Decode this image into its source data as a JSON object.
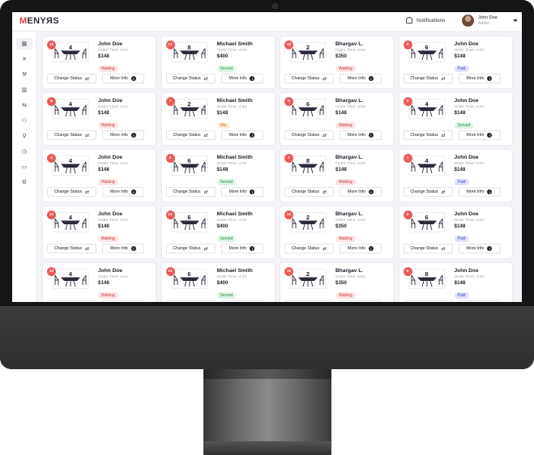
{
  "app": {
    "logo_first": "M",
    "logo_rest": "ENYЯS"
  },
  "header": {
    "notifications_label": "Notifications",
    "user_name": "John Doe",
    "user_role": "Admin"
  },
  "sidebar": {
    "items": [
      {
        "icon": "grid-icon",
        "glyph": "▦",
        "active": true
      },
      {
        "icon": "utensils-icon",
        "glyph": "✕",
        "active": false
      },
      {
        "icon": "tools-icon",
        "glyph": "⚒",
        "active": false
      },
      {
        "icon": "chart-icon",
        "glyph": "▥",
        "active": false
      },
      {
        "icon": "handshake-icon",
        "glyph": "⇆",
        "active": false
      },
      {
        "icon": "users-icon",
        "glyph": "⚇",
        "active": false
      },
      {
        "icon": "user-icon",
        "glyph": "⚲",
        "active": false
      },
      {
        "icon": "clock-icon",
        "glyph": "◷",
        "active": false
      },
      {
        "icon": "message-icon",
        "glyph": "▭",
        "active": false
      },
      {
        "icon": "settings-icon",
        "glyph": "⚙",
        "active": false
      }
    ]
  },
  "labels": {
    "change_status": "Change Status",
    "more_info": "More Info",
    "info_glyph": "i",
    "swap_glyph": "⇄"
  },
  "cards": [
    {
      "table": "12",
      "seats": "4",
      "name": "John Doe",
      "time": "Order Time: 4:04",
      "price": "$148",
      "status": "Waiting"
    },
    {
      "table": "11",
      "seats": "8",
      "name": "Michael Smith",
      "time": "Order Time: 4:04",
      "price": "$400",
      "status": "Served"
    },
    {
      "table": "10",
      "seats": "2",
      "name": "Bhargav L.",
      "time": "Order Time: 4:04",
      "price": "$350",
      "status": "Waiting"
    },
    {
      "table": "9",
      "seats": "6",
      "name": "John Doe",
      "time": "Order Time: 4:04",
      "price": "$148",
      "status": "Paid"
    },
    {
      "table": "8",
      "seats": "4",
      "name": "John Doe",
      "time": "Order Time: 4:04",
      "price": "$148",
      "status": "Waiting"
    },
    {
      "table": "7",
      "seats": "2",
      "name": "Michael Smith",
      "time": "Order Time: 4:04",
      "price": "$148",
      "status": "Idle"
    },
    {
      "table": "6",
      "seats": "6",
      "name": "Bhargav L.",
      "time": "Order Time: 4:04",
      "price": "$148",
      "status": "Waiting"
    },
    {
      "table": "5",
      "seats": "4",
      "name": "John Doe",
      "time": "Order Time: 4:04",
      "price": "$148",
      "status": "Served"
    },
    {
      "table": "4",
      "seats": "4",
      "name": "John Doe",
      "time": "Order Time: 4:04",
      "price": "$148",
      "status": "Waiting"
    },
    {
      "table": "3",
      "seats": "6",
      "name": "Michael Smith",
      "time": "Order Time: 4:04",
      "price": "$148",
      "status": "Served"
    },
    {
      "table": "2",
      "seats": "8",
      "name": "Bhargav L.",
      "time": "Order Time: 4:04",
      "price": "$148",
      "status": "Waiting"
    },
    {
      "table": "1",
      "seats": "4",
      "name": "John Doe",
      "time": "Order Time: 4:04",
      "price": "$148",
      "status": "Paid"
    },
    {
      "table": "12",
      "seats": "4",
      "name": "John Doe",
      "time": "Order Time: 4:04",
      "price": "$148",
      "status": "Waiting"
    },
    {
      "table": "11",
      "seats": "6",
      "name": "Michael Smith",
      "time": "Order Time: 4:04",
      "price": "$400",
      "status": "Served"
    },
    {
      "table": "10",
      "seats": "2",
      "name": "Bhargav L.",
      "time": "Order Time: 4:04",
      "price": "$350",
      "status": "Waiting"
    },
    {
      "table": "9",
      "seats": "6",
      "name": "John Doe",
      "time": "Order Time: 4:04",
      "price": "$148",
      "status": "Paid"
    },
    {
      "table": "12",
      "seats": "4",
      "name": "John Doe",
      "time": "Order Time: 4:04",
      "price": "$148",
      "status": "Waiting"
    },
    {
      "table": "11",
      "seats": "6",
      "name": "Michael Smith",
      "time": "Order Time: 4:04",
      "price": "$400",
      "status": "Served"
    },
    {
      "table": "10",
      "seats": "2",
      "name": "Bhargav L.",
      "time": "Order Time: 4:04",
      "price": "$350",
      "status": "Waiting"
    },
    {
      "table": "9",
      "seats": "8",
      "name": "John Doe",
      "time": "Order Time: 4:04",
      "price": "$148",
      "status": "Paid"
    }
  ],
  "colors": {
    "accent": "#ee5a5a",
    "waiting": "#c13b3b",
    "served": "#2e8c4e",
    "paid": "#3b45b8",
    "idle": "#c17a2a"
  }
}
